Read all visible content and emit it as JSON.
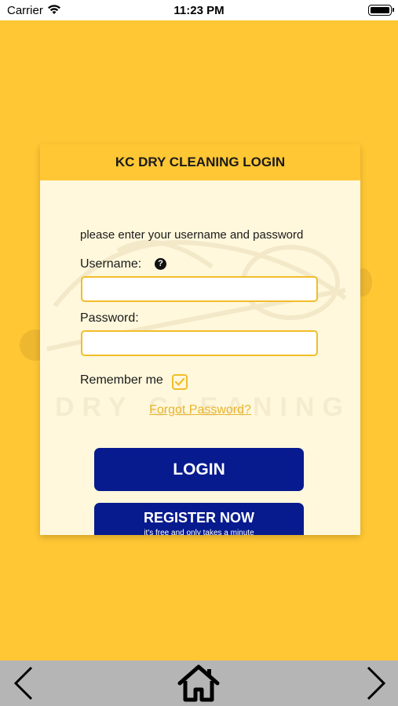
{
  "status_bar": {
    "carrier": "Carrier",
    "time": "11:23 PM",
    "wifi_icon": "wifi-icon",
    "battery_icon": "battery-icon"
  },
  "login": {
    "title": "KC DRY CLEANING LOGIN",
    "subtitle": "please enter your username and password",
    "username_label": "Username:",
    "username_value": "",
    "password_label": "Password:",
    "password_value": "",
    "remember_label": "Remember me",
    "remember_checked": true,
    "forgot_link": "Forgot Password?",
    "login_button": "LOGIN",
    "register_button": "REGISTER NOW",
    "register_subtext": "it's free and only takes a minute"
  },
  "nav": {
    "back_icon": "chevron-left-icon",
    "home_icon": "home-icon",
    "forward_icon": "chevron-right-icon"
  },
  "colors": {
    "background": "#ffc734",
    "card": "#fff8dc",
    "button": "#071b8f",
    "field_border": "#f2bd2a",
    "link": "#e8b52d",
    "nav_bar": "#b5b5b5"
  }
}
